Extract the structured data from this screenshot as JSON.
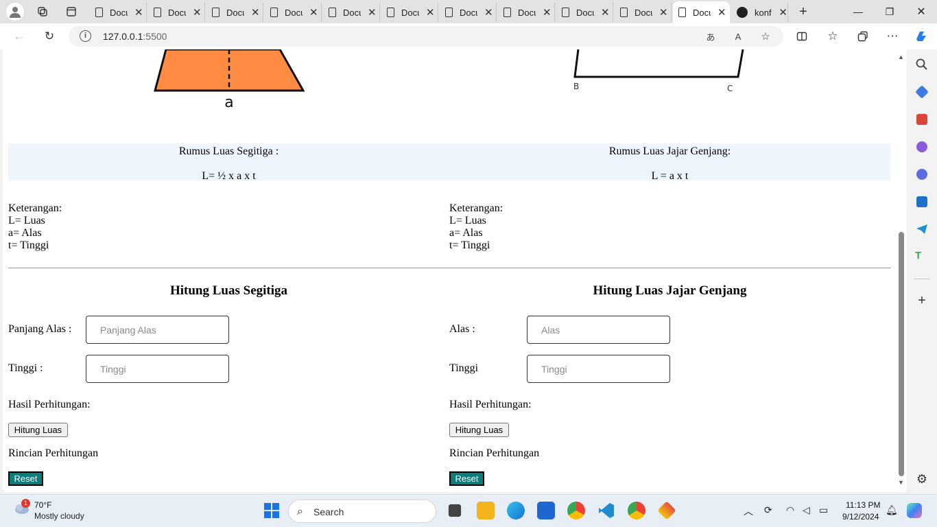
{
  "browser": {
    "tabs": [
      {
        "label": "Document"
      },
      {
        "label": "Document"
      },
      {
        "label": "Document"
      },
      {
        "label": "Document"
      },
      {
        "label": "Document"
      },
      {
        "label": "Document"
      },
      {
        "label": "Document"
      },
      {
        "label": "Document"
      },
      {
        "label": "Document"
      },
      {
        "label": "Document"
      },
      {
        "label": "Document"
      },
      {
        "label": "konf"
      }
    ],
    "url_host": "127.0.0.1",
    "url_port": ":5500"
  },
  "page": {
    "left": {
      "shape_base_label": "a",
      "formula_title": "Rumus Luas Segitiga :",
      "formula_expr": "L= ½ x a x t",
      "ket_title": "Keterangan:",
      "ket_l": "L= Luas",
      "ket_a": "a= Alas",
      "ket_t": "t= Tinggi",
      "calc_title": "Hitung Luas Segitiga",
      "field1_label": "Panjang Alas :",
      "field1_placeholder": "Panjang Alas",
      "field2_label": "Tinggi :",
      "field2_placeholder": "Tinggi",
      "result_label": "Hasil Perhitungan:",
      "hitung_button": "Hitung Luas",
      "rincian_label": "Rincian Perhitungan",
      "reset_button": "Reset"
    },
    "right": {
      "vertex_b": "B",
      "vertex_c": "C",
      "formula_title": "Rumus Luas Jajar Genjang:",
      "formula_expr": "L = a x t",
      "ket_title": "Keterangan:",
      "ket_l": "L= Luas",
      "ket_a": "a= Alas",
      "ket_t": "t= Tinggi",
      "calc_title": "Hitung Luas Jajar Genjang",
      "field1_label": "Alas :",
      "field1_placeholder": "Alas",
      "field2_label": "Tinggi",
      "field2_placeholder": "Tinggi",
      "result_label": "Hasil Perhitungan:",
      "hitung_button": "Hitung Luas",
      "rincian_label": "Rincian Perhitungan",
      "reset_button": "Reset"
    }
  },
  "taskbar": {
    "weather_temp": "70°F",
    "weather_desc": "Mostly cloudy",
    "weather_badge": "1",
    "search_text": "Search",
    "time": "11:13 PM",
    "date": "9/12/2024"
  },
  "colors": {
    "triangle_fill": "#ff8c42",
    "formula_bg": "#eef5fd",
    "reset_bg": "#0e7c7b"
  }
}
